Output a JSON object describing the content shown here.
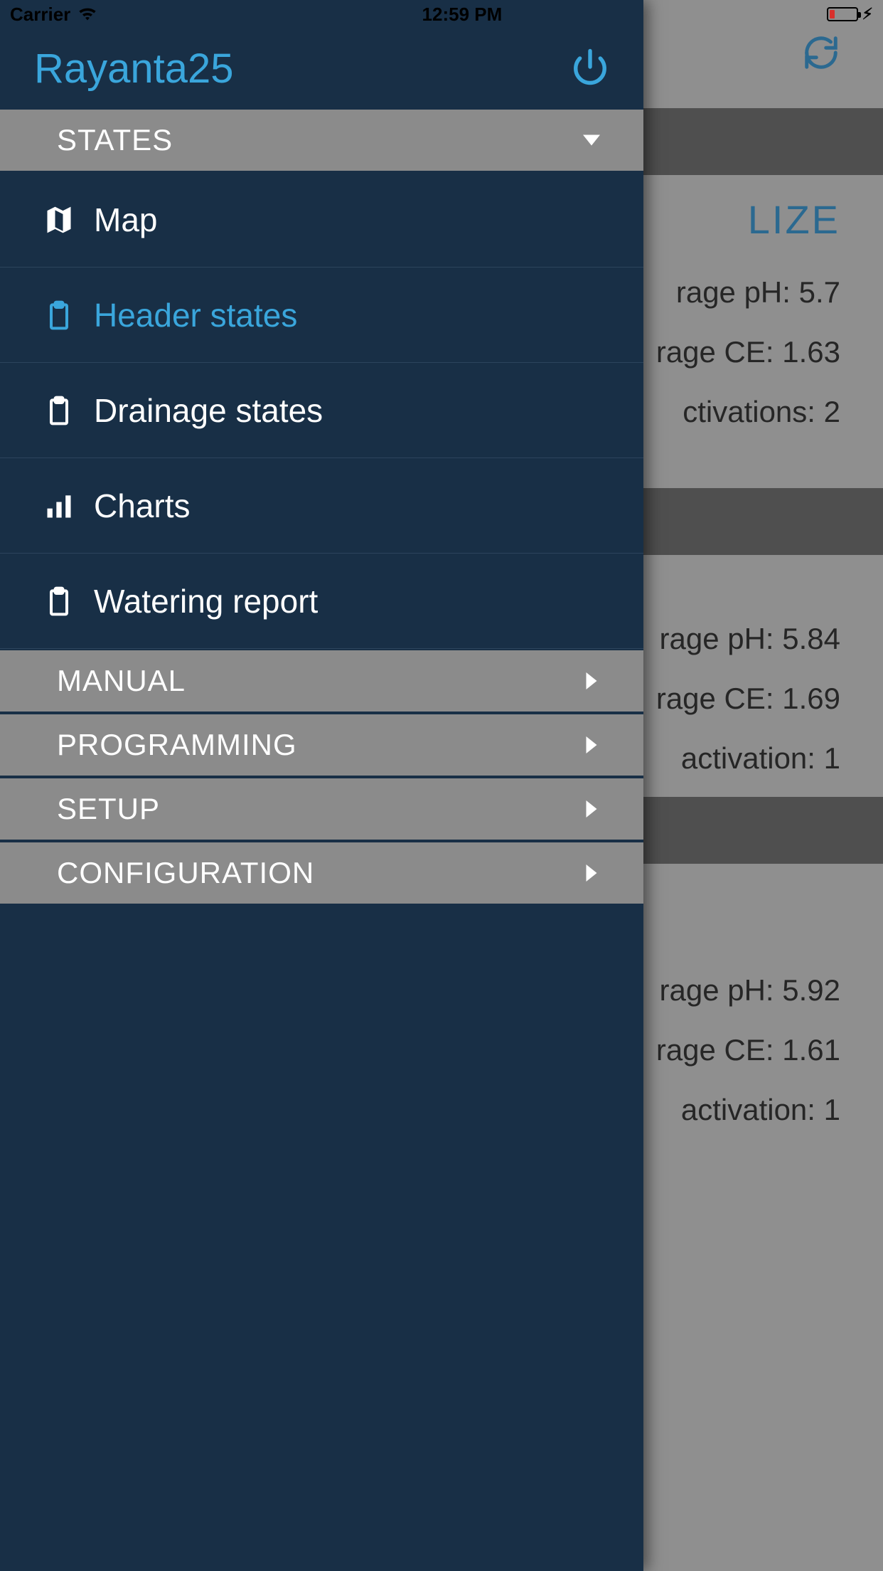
{
  "statusbar": {
    "carrier": "Carrier",
    "time": "12:59 PM"
  },
  "drawer": {
    "title": "Rayanta25",
    "sections": {
      "states": {
        "label": "STATES",
        "expanded": true,
        "items": {
          "map": "Map",
          "header_states": "Header states",
          "drainage_states": "Drainage states",
          "charts": "Charts",
          "watering_report": "Watering report"
        }
      },
      "manual": {
        "label": "MANUAL",
        "expanded": false
      },
      "programming": {
        "label": "PROGRAMMING",
        "expanded": false
      },
      "setup": {
        "label": "SETUP",
        "expanded": false
      },
      "configuration": {
        "label": "CONFIGURATION",
        "expanded": false
      }
    }
  },
  "content": {
    "panel1": {
      "title_suffix": "LIZE",
      "ph_label": "rage pH:",
      "ph_value": "5.7",
      "ce_label": "rage CE:",
      "ce_value": "1.63",
      "act_label": "ctivations:",
      "act_value": "2"
    },
    "panel2": {
      "ph_label": "rage pH:",
      "ph_value": "5.84",
      "ce_label": "rage CE:",
      "ce_value": "1.69",
      "act_label": "activation:",
      "act_value": "1"
    },
    "panel3": {
      "ph_label": "rage pH:",
      "ph_value": "5.92",
      "ce_label": "rage CE:",
      "ce_value": "1.61",
      "act_label": "activation:",
      "act_value": "1"
    }
  },
  "icons": {
    "power": "power-icon",
    "refresh": "refresh-icon",
    "map": "map-icon",
    "clipboard": "clipboard-icon",
    "charts": "bar-chart-icon",
    "caret_down": "caret-down-icon",
    "caret_right": "caret-right-icon",
    "wifi": "wifi-icon",
    "battery": "battery-icon",
    "bolt": "bolt-icon"
  },
  "colors": {
    "accent": "#3aa6dc",
    "drawer_bg": "#182f46",
    "section_bg": "#8b8b8b",
    "content_bg": "#bfbfbf",
    "section_bar": "#6a6a6a"
  }
}
